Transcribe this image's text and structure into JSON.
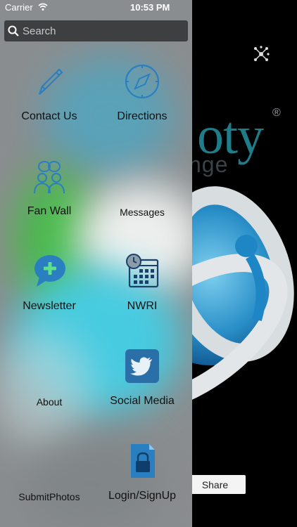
{
  "status_bar": {
    "carrier": "Carrier",
    "time": "10:53 PM"
  },
  "search": {
    "placeholder": "Search"
  },
  "menu_items": [
    {
      "label": "Contact Us",
      "icon": "pencil-icon"
    },
    {
      "label": "Directions",
      "icon": "compass-icon"
    },
    {
      "label": "Fan Wall",
      "icon": "people-icon"
    },
    {
      "label": "Messages",
      "icon": ""
    },
    {
      "label": "Newsletter",
      "icon": "chat-plus-icon"
    },
    {
      "label": "NWRI",
      "icon": "calendar-clock-icon"
    },
    {
      "label": "About",
      "icon": ""
    },
    {
      "label": "Social Media",
      "icon": "twitter-icon"
    },
    {
      "label": "SubmitPhotos",
      "icon": ""
    },
    {
      "label": "Login/SignUp",
      "icon": "lock-document-icon"
    }
  ],
  "background": {
    "logo_text": "oty",
    "logo_sub": "nge",
    "registered_mark": "®",
    "share_label": "Share"
  },
  "colors": {
    "accent": "#2a7fc0",
    "search_bg": "#3e3f40",
    "drawer_bg": "#8a8d8f"
  }
}
